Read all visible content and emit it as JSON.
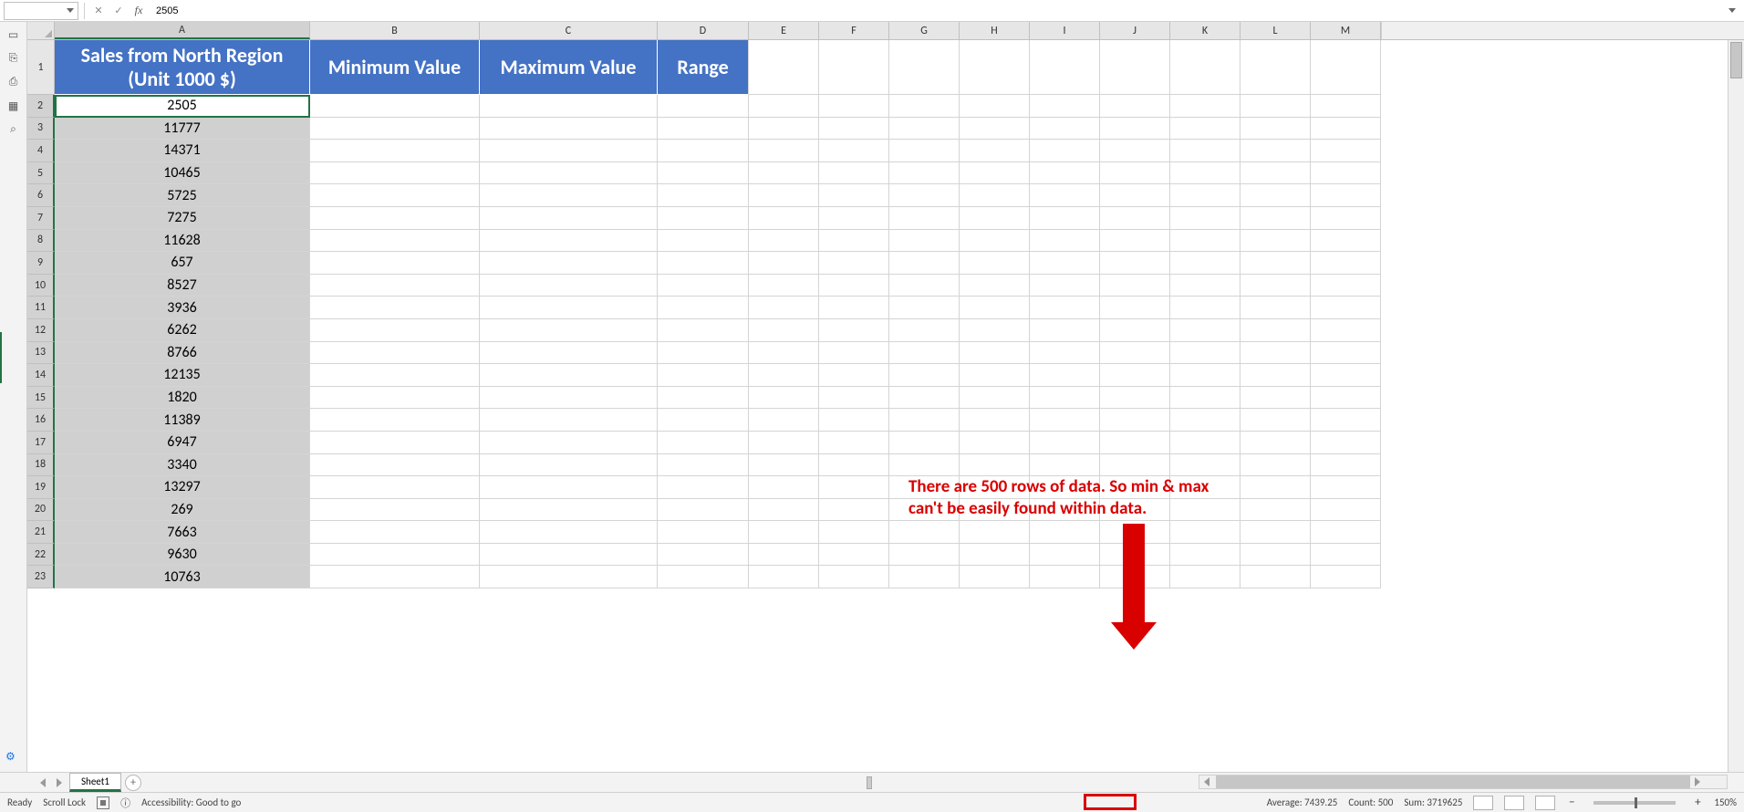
{
  "formula_bar": {
    "namebox": "",
    "cancel_glyph": "✕",
    "enter_glyph": "✓",
    "fx_label": "fx",
    "value": "2505"
  },
  "columns": {
    "A": "A",
    "B": "B",
    "C": "C",
    "D": "D",
    "E": "E",
    "F": "F",
    "G": "G",
    "H": "H",
    "I": "I",
    "J": "J",
    "K": "K",
    "L": "L",
    "M": "M"
  },
  "header_row": {
    "A": "Sales from North Region\n(Unit 1000 $)",
    "B": "Minimum Value",
    "C": "Maximum Value",
    "D": "Range"
  },
  "data_rows": [
    {
      "n": 2,
      "A": "2505"
    },
    {
      "n": 3,
      "A": "11777"
    },
    {
      "n": 4,
      "A": "14371"
    },
    {
      "n": 5,
      "A": "10465"
    },
    {
      "n": 6,
      "A": "5725"
    },
    {
      "n": 7,
      "A": "7275"
    },
    {
      "n": 8,
      "A": "11628"
    },
    {
      "n": 9,
      "A": "657"
    },
    {
      "n": 10,
      "A": "8527"
    },
    {
      "n": 11,
      "A": "3936"
    },
    {
      "n": 12,
      "A": "6262"
    },
    {
      "n": 13,
      "A": "8766"
    },
    {
      "n": 14,
      "A": "12135"
    },
    {
      "n": 15,
      "A": "1820"
    },
    {
      "n": 16,
      "A": "11389"
    },
    {
      "n": 17,
      "A": "6947"
    },
    {
      "n": 18,
      "A": "3340"
    },
    {
      "n": 19,
      "A": "13297"
    },
    {
      "n": 20,
      "A": "269"
    },
    {
      "n": 21,
      "A": "7663"
    },
    {
      "n": 22,
      "A": "9630"
    },
    {
      "n": 23,
      "A": "10763"
    }
  ],
  "annotation": {
    "line1": "There are 500 rows of data. So min & max",
    "line2": "can't be easily found within data."
  },
  "tabstrip": {
    "sheet1": "Sheet1",
    "add": "+"
  },
  "statusbar": {
    "ready": "Ready",
    "scroll_lock": "Scroll Lock",
    "accessibility": "Accessibility: Good to go",
    "average": "Average: 7439.25",
    "count": "Count: 500",
    "sum": "Sum: 3719625",
    "zoom": "150%"
  }
}
